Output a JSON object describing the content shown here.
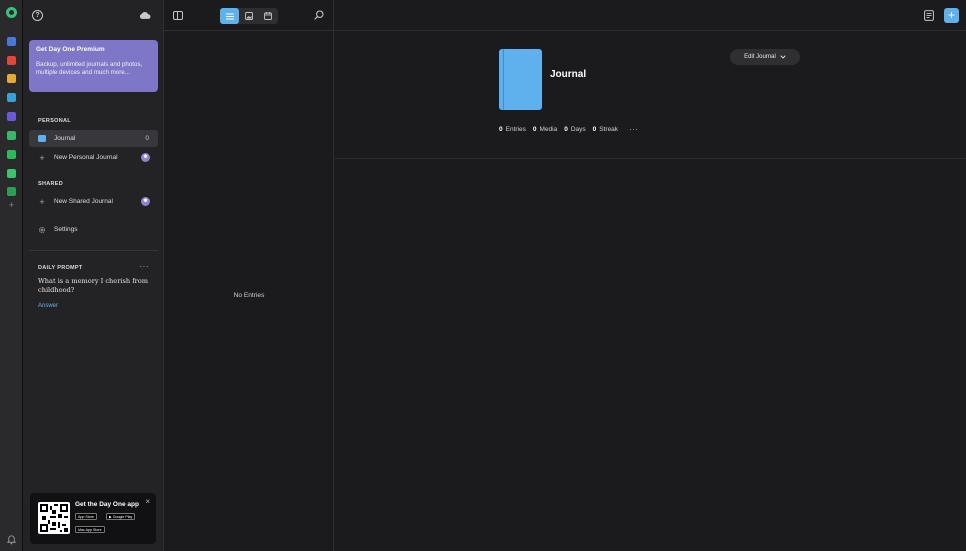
{
  "rail": {
    "apps": [
      {
        "name": "app-finder",
        "color": "#4a78d8"
      },
      {
        "name": "app-calendar",
        "color": "#e0463a"
      },
      {
        "name": "app-notes",
        "color": "#e5a93a"
      },
      {
        "name": "app-browser",
        "color": "#3aa0d8"
      },
      {
        "name": "app-tasks",
        "color": "#6a5ad8"
      },
      {
        "name": "app-messages",
        "color": "#39b86a"
      },
      {
        "name": "app-spotify",
        "color": "#2dba5a"
      },
      {
        "name": "app-mail",
        "color": "#3cc46a"
      },
      {
        "name": "app-sheets",
        "color": "#2e9e52"
      }
    ]
  },
  "sidebar": {
    "premium": {
      "title": "Get Day One Premium",
      "description": "Backup, unlimited journals and photos, multiple devices and much more..."
    },
    "personal_label": "PERSONAL",
    "journal_item": {
      "label": "Journal",
      "count": "0"
    },
    "new_personal": {
      "label": "New Personal Journal",
      "badge": "✱"
    },
    "shared_label": "SHARED",
    "new_shared": {
      "label": "New Shared Journal",
      "badge": "✱"
    },
    "settings_label": "Settings",
    "daily_prompt": {
      "label": "DAILY PROMPT",
      "more": "···",
      "text": "What is a memory I cherish from childhood?",
      "answer": "Answer"
    },
    "app_card": {
      "title": "Get the Day One app",
      "close": "×",
      "app_store": " App Store",
      "google_play": "▶ Google Play",
      "mac_app_store": " Mac App Store"
    }
  },
  "list": {
    "empty_text": "No Entries"
  },
  "main": {
    "journal_title": "Journal",
    "edit_button": "Edit Journal",
    "add_button": "+",
    "stats": {
      "entries_value": "0",
      "entries_label": "Entries",
      "media_value": "0",
      "media_label": "Media",
      "days_value": "0",
      "days_label": "Days",
      "streak_value": "0",
      "streak_label": "Streak",
      "more": "···"
    }
  },
  "colors": {
    "accent": "#5eb1ec",
    "premium": "#7e76c6"
  }
}
